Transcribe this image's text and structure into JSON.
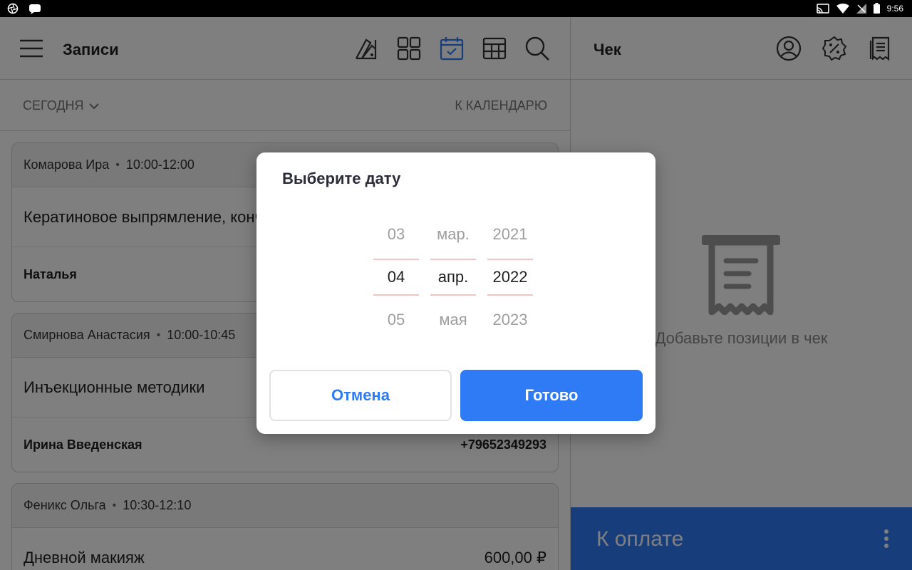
{
  "status_bar": {
    "time": "9:56"
  },
  "records": {
    "title": "Записи",
    "today_label": "СЕГОДНЯ",
    "to_calendar_label": "К КАЛЕНДАРЮ",
    "cards": [
      {
        "client": "Комарова Ира",
        "time": "10:00-12:00",
        "service": "Кератиновое выпрямление, кончики",
        "master": "Наталья",
        "right": ""
      },
      {
        "client": "Смирнова Анастасия",
        "time": "10:00-10:45",
        "service": "Инъекционные методики",
        "master": "Ирина Введенская",
        "right": "+79652349293"
      },
      {
        "client": "Феникс Ольга",
        "time": "10:30-12:10",
        "service": "Дневной макияж",
        "price": "600,00 ₽"
      }
    ]
  },
  "check": {
    "title": "Чек",
    "empty_text": "Добавьте позиции в чек",
    "pay_label": "К оплате"
  },
  "dialog": {
    "title": "Выберите дату",
    "day": {
      "prev": "03",
      "selected": "04",
      "next": "05"
    },
    "month": {
      "prev": "мар.",
      "selected": "апр.",
      "next": "мая"
    },
    "year": {
      "prev": "2021",
      "selected": "2022",
      "next": "2023"
    },
    "cancel_label": "Отмена",
    "done_label": "Готово"
  },
  "colors": {
    "accent": "#2f7bf6",
    "scrim": "rgba(0,0,0,0.5)"
  }
}
